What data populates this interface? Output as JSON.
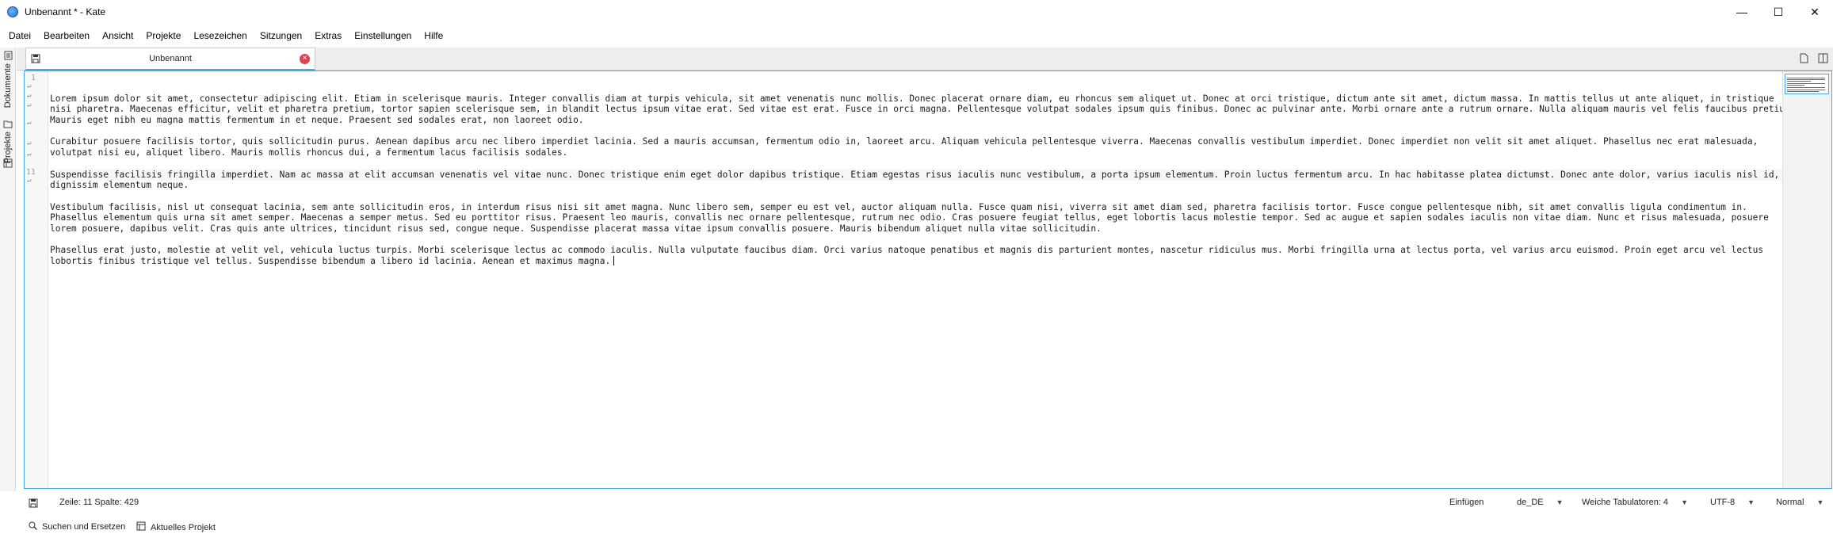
{
  "window": {
    "title": "Unbenannt * - Kate",
    "minimize_glyph": "—",
    "maximize_glyph": "☐",
    "close_glyph": "✕"
  },
  "menu": [
    "Datei",
    "Bearbeiten",
    "Ansicht",
    "Projekte",
    "Lesezeichen",
    "Sitzungen",
    "Extras",
    "Einstellungen",
    "Hilfe"
  ],
  "sidebar": {
    "tabs": [
      {
        "label": "Dokumente",
        "icon": "documents-icon"
      },
      {
        "label": "Projekte",
        "icon": "projects-icon"
      }
    ]
  },
  "tab": {
    "label": "Unbenannt",
    "close_glyph": "×"
  },
  "editor": {
    "line_numbers": {
      "first": "1",
      "current": "11"
    },
    "paragraphs": [
      "Lorem ipsum dolor sit amet, consectetur adipiscing elit. Etiam in scelerisque mauris. Integer convallis diam at turpis vehicula, sit amet venenatis nunc mollis. Donec placerat ornare diam, eu rhoncus sem aliquet ut. Donec at orci tristique, dictum ante sit amet, dictum massa. In mattis tellus ut ante aliquet, in tristique nisi pharetra. Maecenas efficitur, velit et pharetra pretium, tortor sapien scelerisque sem, in blandit lectus ipsum vitae erat. Sed vitae est erat. Fusce in orci magna. Pellentesque volutpat sodales ipsum quis finibus. Donec ac pulvinar ante. Morbi ornare ante a rutrum ornare. Nulla aliquam mauris vel felis faucibus pretium. Mauris eget nibh eu magna mattis fermentum in et neque. Praesent sed sodales erat, non laoreet odio.",
      "Curabitur posuere facilisis tortor, quis sollicitudin purus. Aenean dapibus arcu nec libero imperdiet lacinia. Sed a mauris accumsan, fermentum odio in, laoreet arcu. Aliquam vehicula pellentesque viverra. Maecenas convallis vestibulum imperdiet. Donec imperdiet non velit sit amet aliquet. Phasellus nec erat malesuada, volutpat nisi eu, aliquet libero. Mauris mollis rhoncus dui, a fermentum lacus facilisis sodales.",
      "Suspendisse facilisis fringilla imperdiet. Nam ac massa at elit accumsan venenatis vel vitae nunc. Donec tristique enim eget dolor dapibus tristique. Etiam egestas risus iaculis nunc vestibulum, a porta ipsum elementum. Proin luctus fermentum arcu. In hac habitasse platea dictumst. Donec ante dolor, varius iaculis nisl id, dignissim elementum neque.",
      "Vestibulum facilisis, nisl ut consequat lacinia, sem ante sollicitudin eros, in interdum risus nisi sit amet magna. Nunc libero sem, semper eu est vel, auctor aliquam nulla. Fusce quam nisi, viverra sit amet diam sed, pharetra facilisis tortor. Fusce congue pellentesque nibh, sit amet convallis ligula condimentum in. Phasellus elementum quis urna sit amet semper. Maecenas a semper metus. Sed eu porttitor risus. Praesent leo mauris, convallis nec ornare pellentesque, rutrum nec odio. Cras posuere feugiat tellus, eget lobortis lacus molestie tempor. Sed ac augue et sapien sodales iaculis non vitae diam. Nunc et risus malesuada, posuere lorem posuere, dapibus velit. Cras quis ante ultrices, tincidunt risus sed, congue neque. Suspendisse placerat massa vitae ipsum convallis posuere. Mauris bibendum aliquet nulla vitae sollicitudin.",
      "Phasellus erat justo, molestie at velit vel, vehicula luctus turpis. Morbi scelerisque lectus ac commodo iaculis. Nulla vulputate faucibus diam. Orci varius natoque penatibus et magnis dis parturient montes, nascetur ridiculus mus. Morbi fringilla urna at lectus porta, vel varius arcu euismod. Proin eget arcu vel lectus lobortis finibus tristique vel tellus. Suspendisse bibendum a libero id lacinia. Aenean et maximus magna."
    ]
  },
  "status": {
    "position": "Zeile: 11 Spalte: 429",
    "mode": "Einfügen",
    "language": "de_DE",
    "indent": "Weiche Tabulatoren: 4",
    "encoding": "UTF-8",
    "syntax": "Normal"
  },
  "bottom": {
    "search": "Suchen und Ersetzen",
    "project": "Aktuelles Projekt"
  },
  "colors": {
    "accent": "#3daee9",
    "close": "#da4453"
  }
}
